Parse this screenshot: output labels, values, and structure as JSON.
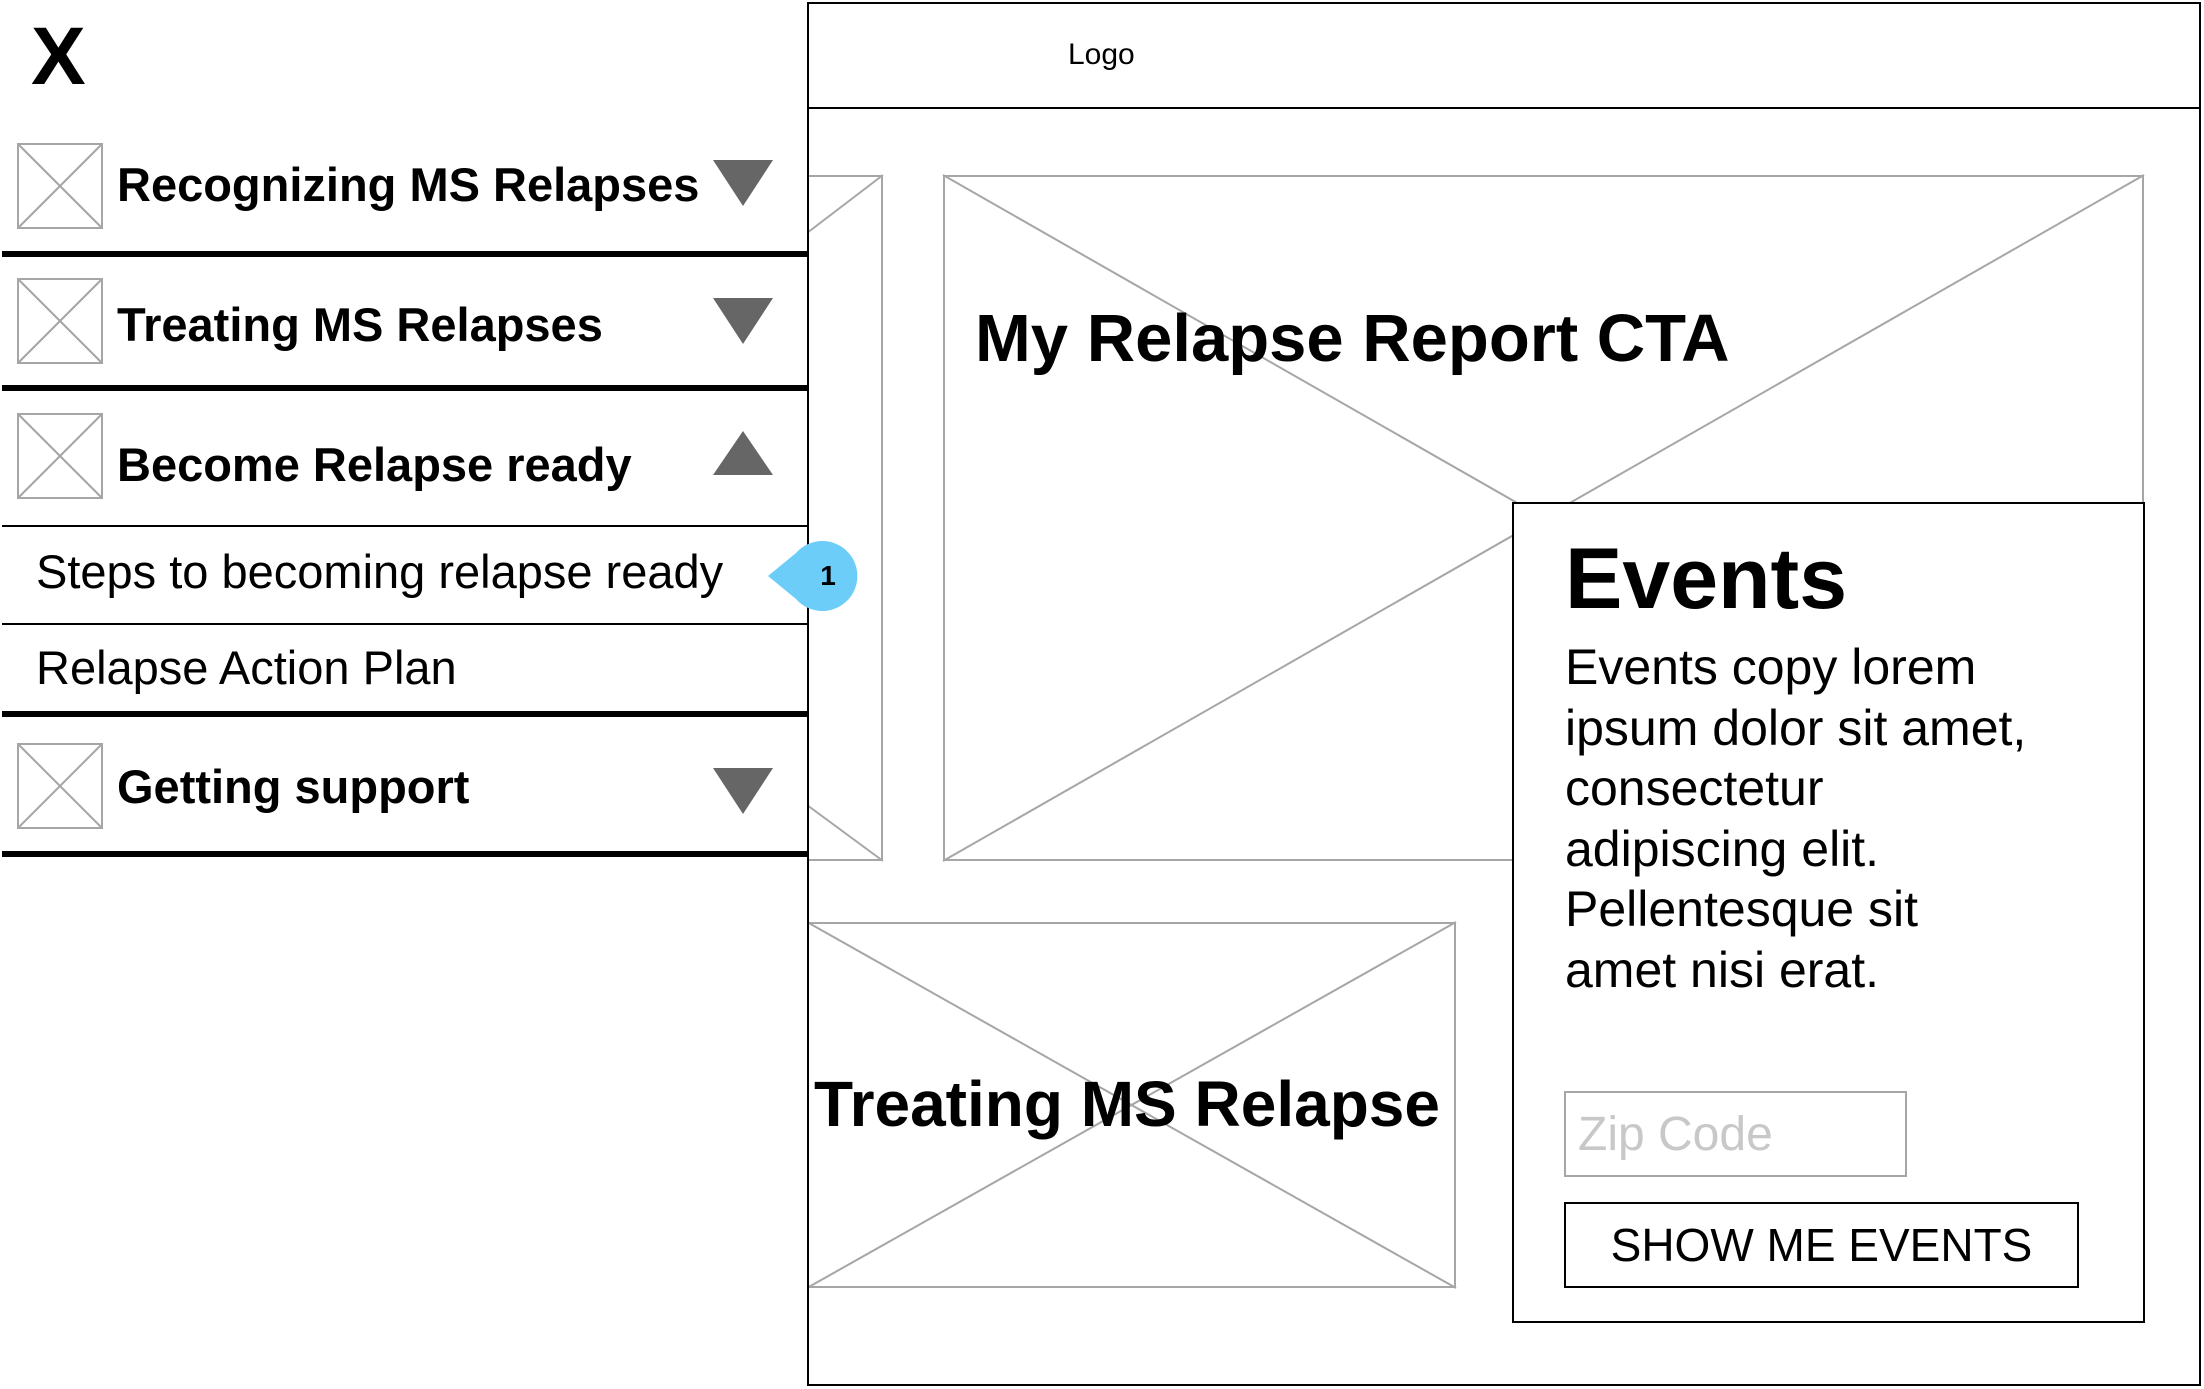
{
  "header": {
    "logo": "Logo"
  },
  "main": {
    "hero_title": "My Relapse Report CTA",
    "bottom_card_title": "Treating MS Relapse"
  },
  "events": {
    "title": "Events",
    "copy": "Events copy lorem ipsum dolor sit amet, consectetur adipiscing elit. Pellentesque sit amet nisi erat.",
    "zip_placeholder": "Zip Code",
    "zip_value": "",
    "button_label": "SHOW ME EVENTS"
  },
  "sidebar": {
    "close_label": "X",
    "items": [
      {
        "label": "Recognizing MS Relapses",
        "expanded": false
      },
      {
        "label": "Treating MS Relapses",
        "expanded": false
      },
      {
        "label": "Become Relapse ready",
        "expanded": true,
        "subitems": [
          "Steps to becoming relapse ready",
          "Relapse Action Plan"
        ]
      },
      {
        "label": "Getting support",
        "expanded": false
      }
    ]
  },
  "annotation": {
    "badge_number": "1",
    "badge_color": "#6ccdf8"
  },
  "colors": {
    "placeholder_border": "#a6a6a6",
    "arrow": "#666666"
  }
}
